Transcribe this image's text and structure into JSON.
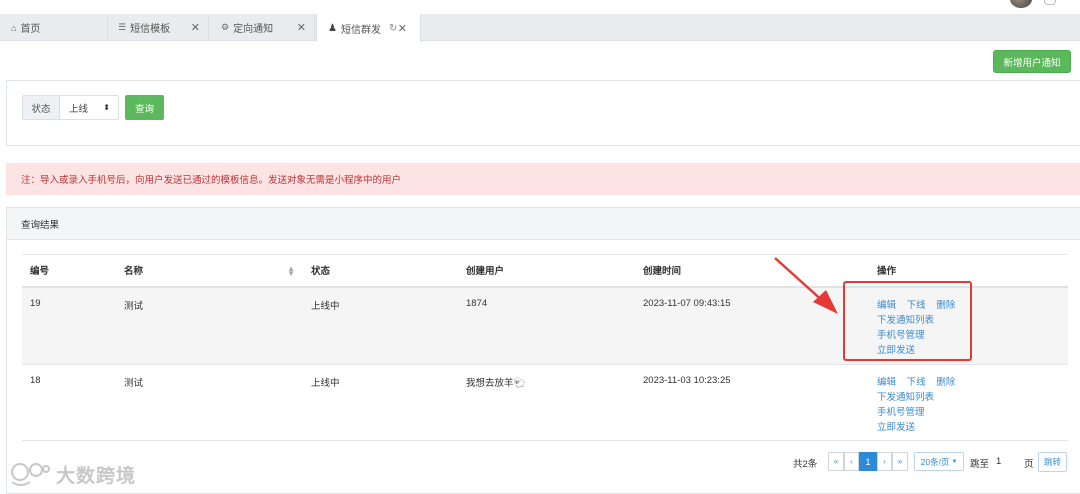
{
  "tabs": [
    {
      "icon": "home-icon",
      "glyph": "⌂",
      "label": "首页",
      "closable": false
    },
    {
      "icon": "list-icon",
      "glyph": "☰",
      "label": "短信模板",
      "closable": true
    },
    {
      "icon": "gear-icon",
      "glyph": "⚙",
      "label": "定向通知",
      "closable": true
    },
    {
      "icon": "user-icon",
      "glyph": "♟",
      "label": "短信群发",
      "closable": true,
      "active": true
    }
  ],
  "header": {
    "new_button": "新增用户通知"
  },
  "search": {
    "status_label": "状态",
    "status_value": "上线",
    "query_button": "查询"
  },
  "notice": "注：导入或录入手机号后，向用户发送已通过的模板信息。发送对象无需是小程序中的用户",
  "results": {
    "title": "查询结果",
    "columns": [
      "编号",
      "名称",
      "状态",
      "创建用户",
      "创建时间",
      "操作"
    ],
    "rows": [
      {
        "id": "19",
        "name": "测试",
        "status": "上线中",
        "creator": "1874",
        "created": "2023-11-07 09:43:15"
      },
      {
        "id": "18",
        "name": "测试",
        "status": "上线中",
        "creator": "我想去放羊🐑",
        "created": "2023-11-03 10:23:25"
      }
    ],
    "actions": {
      "edit": "编辑",
      "offline": "下线",
      "delete": "删除",
      "notify_list": "下发通知列表",
      "phone_manage": "手机号管理",
      "send_now": "立即发送"
    }
  },
  "pager": {
    "total": "共2条",
    "first": "«",
    "prev": "‹",
    "current": "1",
    "next": "›",
    "last": "»",
    "page_size": "20条/页",
    "goto_label": "跳至",
    "goto_value": "1",
    "goto_unit": "页",
    "jump_button": "跳转"
  },
  "watermark": "大数跨境",
  "colors": {
    "primary_green": "#5cb85c",
    "link_blue": "#3a8bd0",
    "highlight_red": "#e53935",
    "notice_bg": "#fde3e3"
  }
}
